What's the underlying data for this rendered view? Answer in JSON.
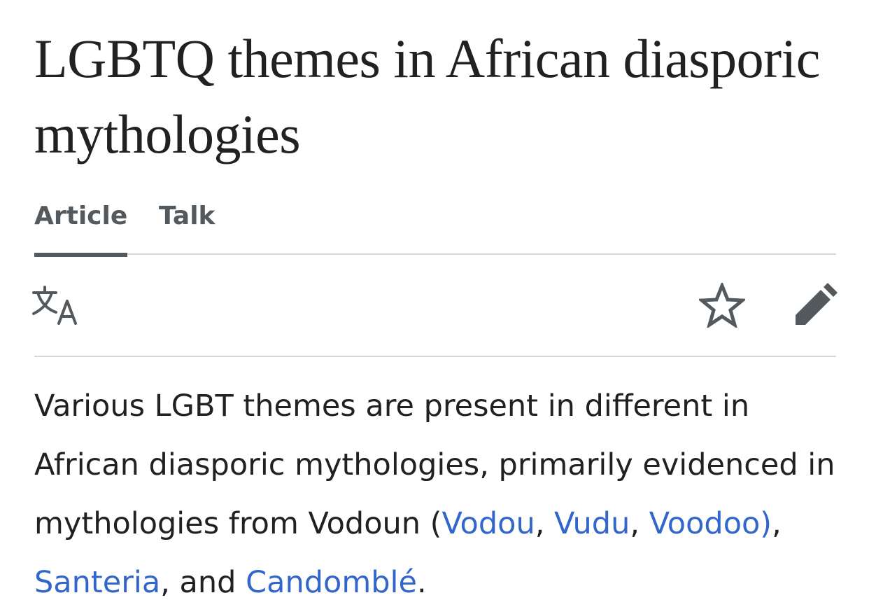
{
  "article": {
    "title": "LGBTQ themes in African diasporic mythologies"
  },
  "tabs": [
    {
      "label": "Article",
      "active": true
    },
    {
      "label": "Talk",
      "active": false
    }
  ],
  "toolbar": {
    "icons": {
      "language": "translate-icon",
      "watch": "star-icon",
      "edit": "pencil-icon"
    }
  },
  "body": {
    "segments": [
      {
        "text": "Various LGBT themes are present in different in African diasporic mythologies, primarily evidenced in mythologies from Vodoun (",
        "link": false
      },
      {
        "text": "Vodou",
        "link": true
      },
      {
        "text": ", ",
        "link": false
      },
      {
        "text": "Vudu",
        "link": true
      },
      {
        "text": ", ",
        "link": false
      },
      {
        "text": "Voodoo)",
        "link": true
      },
      {
        "text": ", ",
        "link": false
      },
      {
        "text": "Santeria",
        "link": true
      },
      {
        "text": ", and ",
        "link": false
      },
      {
        "text": "Candomblé",
        "link": true
      },
      {
        "text": ".",
        "link": false
      }
    ]
  },
  "colors": {
    "text": "#202122",
    "link": "#3366cc",
    "tab": "#54595d",
    "divider": "#d8d9da"
  }
}
